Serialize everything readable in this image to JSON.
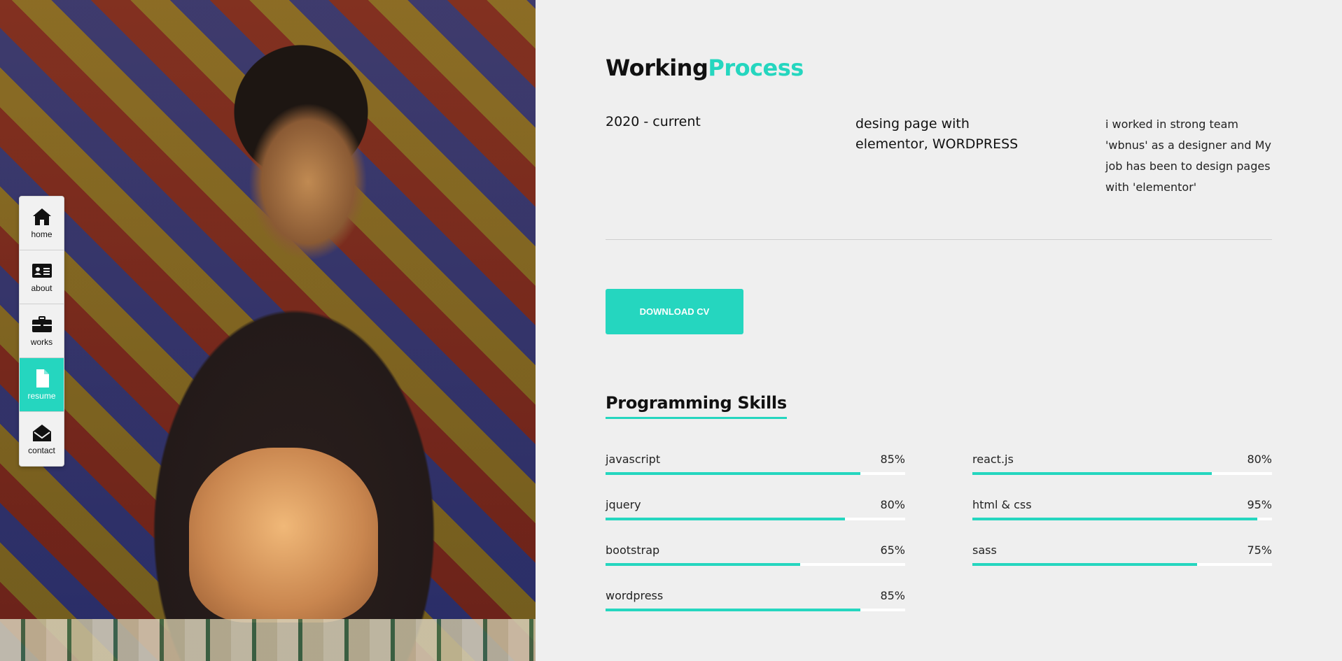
{
  "nav": {
    "items": [
      {
        "label": "home",
        "icon": "home-icon",
        "active": false
      },
      {
        "label": "about",
        "icon": "id-card-icon",
        "active": false
      },
      {
        "label": "works",
        "icon": "briefcase-icon",
        "active": false
      },
      {
        "label": "resume",
        "icon": "file-icon",
        "active": true
      },
      {
        "label": "contact",
        "icon": "envelope-open-icon",
        "active": false
      }
    ]
  },
  "experience": {
    "title_part1": "Working",
    "title_part2": "Process",
    "date": "2020 - current",
    "role": "desing page with elementor, WORDPRESS",
    "description": "i worked in strong team 'wbnus' as a designer and My job has been to design pages with 'elementor'"
  },
  "download_cv_label": "DOWNLOAD CV",
  "skills": {
    "title": "Programming Skills",
    "left": [
      {
        "name": "javascript",
        "percent_label": "85%",
        "value": 85
      },
      {
        "name": "jquery",
        "percent_label": "80%",
        "value": 80
      },
      {
        "name": "bootstrap",
        "percent_label": "65%",
        "value": 65
      },
      {
        "name": "wordpress",
        "percent_label": "85%",
        "value": 85
      }
    ],
    "right": [
      {
        "name": "react.js",
        "percent_label": "80%",
        "value": 80
      },
      {
        "name": "html & css",
        "percent_label": "95%",
        "value": 95
      },
      {
        "name": "sass",
        "percent_label": "75%",
        "value": 75
      }
    ]
  },
  "colors": {
    "accent": "#25d6bf",
    "background": "#efefef",
    "text": "#111111"
  }
}
